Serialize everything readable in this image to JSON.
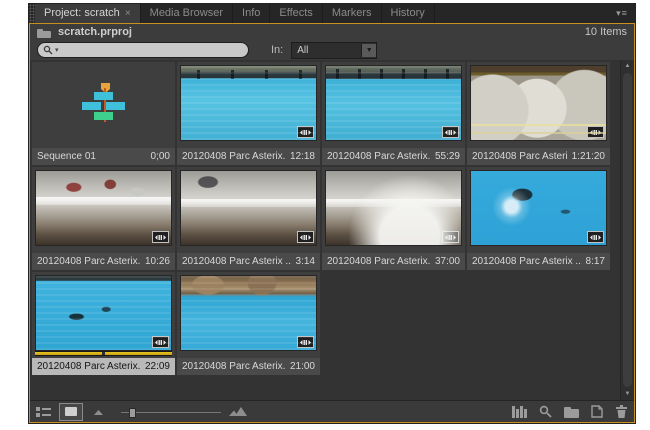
{
  "panel": {
    "project_file": "scratch.prproj",
    "items_count": "10 Items",
    "close_label": "×",
    "menu_label": "▾≡",
    "accent_color": "#c8901e"
  },
  "tabs": [
    {
      "label": "Project: scratch",
      "active": true
    },
    {
      "label": "Media Browser"
    },
    {
      "label": "Info"
    },
    {
      "label": "Effects"
    },
    {
      "label": "Markers"
    },
    {
      "label": "History"
    }
  ],
  "search": {
    "value": "",
    "placeholder": "",
    "in_label": "In:",
    "in_value": "All"
  },
  "scrollbar": {
    "up_label": "▲",
    "down_label": "▼"
  },
  "items": [
    {
      "name": "Sequence 01",
      "duration": "0;00",
      "type": "sequence"
    },
    {
      "name": "20120408 Parc Asterix...",
      "duration": "12:18",
      "type": "clip",
      "scene": "pool-trainers"
    },
    {
      "name": "20120408 Parc Asterix...",
      "duration": "55:29",
      "type": "clip",
      "scene": "pool-show"
    },
    {
      "name": "20120408 Parc Asteri...",
      "duration": "1:21:20",
      "type": "clip",
      "scene": "zorb"
    },
    {
      "name": "20120408 Parc Asterix...",
      "duration": "10:26",
      "type": "clip",
      "scene": "arena"
    },
    {
      "name": "20120408 Parc Asterix ...",
      "duration": "3:14",
      "type": "clip",
      "scene": "arena2"
    },
    {
      "name": "20120408 Parc Asterix...",
      "duration": "37:00",
      "type": "clip",
      "scene": "arena-smoke"
    },
    {
      "name": "20120408 Parc Asterix ...",
      "duration": "8:17",
      "type": "clip",
      "scene": "dolphin-jump"
    },
    {
      "name": "20120408 Parc Asterix...",
      "duration": "22:09",
      "type": "clip",
      "scene": "pool-dolphins",
      "selected": true
    },
    {
      "name": "20120408 Parc Asterix...",
      "duration": "21:00",
      "type": "clip",
      "scene": "pool-rocks"
    }
  ]
}
